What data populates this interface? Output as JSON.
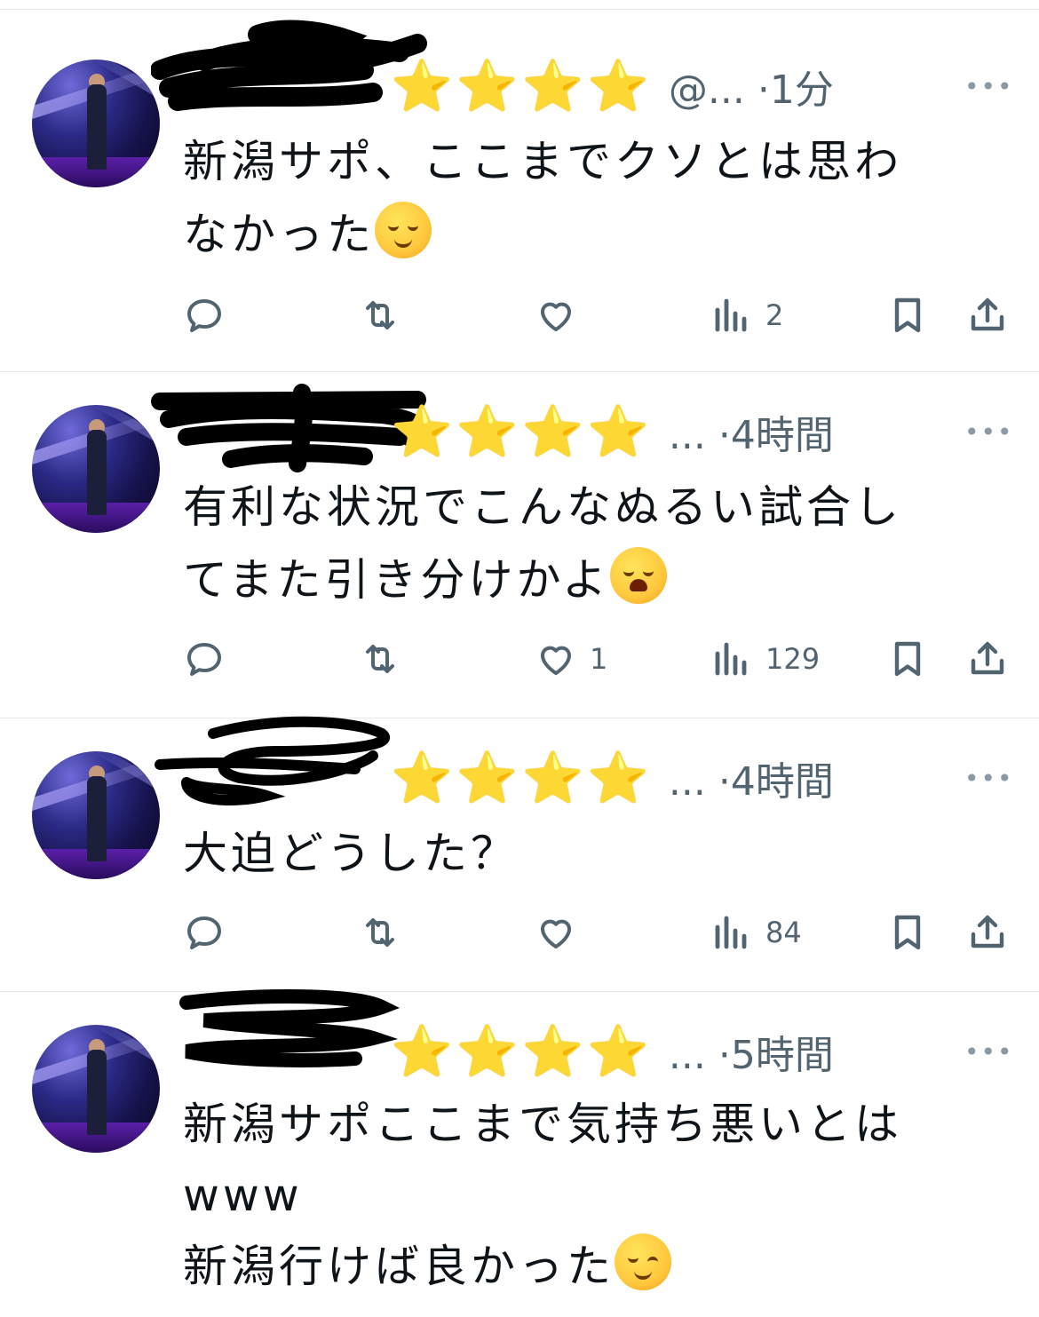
{
  "tweets": [
    {
      "stars": "⭐⭐⭐⭐",
      "meta": "@... ·1分",
      "text": "新潟サポ、ここまでクソとは思わ\nなかった",
      "emoji": "relieved-face",
      "counts": {
        "reply": "",
        "retweet": "",
        "like": "",
        "views": "2"
      }
    },
    {
      "stars": "⭐⭐⭐⭐",
      "meta": "... ·4時間",
      "text": "有利な状況でこんなぬるい試合し\nてまた引き分けかよ",
      "emoji": "weary-face",
      "counts": {
        "reply": "",
        "retweet": "",
        "like": "1",
        "views": "129"
      }
    },
    {
      "stars": "⭐⭐⭐⭐",
      "meta": "... ·4時間",
      "text": "大迫どうした？",
      "emoji": "",
      "counts": {
        "reply": "",
        "retweet": "",
        "like": "",
        "views": "84"
      }
    },
    {
      "stars": "⭐⭐⭐⭐",
      "meta": "... ·5時間",
      "text": "新潟サポここまで気持ち悪いとは\nwww\n新潟行けば良かった",
      "emoji": "winking-face",
      "counts": {
        "reply": "",
        "retweet": "",
        "like": "",
        "views": ""
      }
    }
  ],
  "more_label": "•••",
  "colors": {
    "text": "#0f1419",
    "secondary": "#536471",
    "divider": "#e6e9ec",
    "star": "#f5b800"
  }
}
